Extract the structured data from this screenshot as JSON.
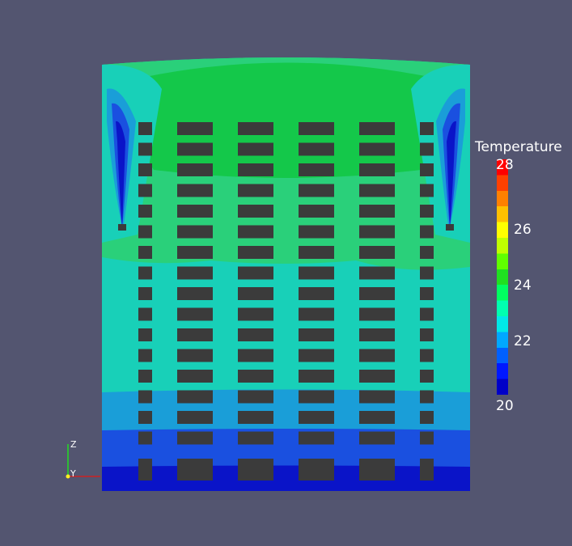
{
  "colorbar": {
    "title": "Temperature",
    "tick_labels": [
      "28",
      "26",
      "24",
      "22",
      "20"
    ],
    "colors": [
      "#0000c8",
      "#0018ff",
      "#0060ff",
      "#00a8ff",
      "#00e8e8",
      "#00ffb0",
      "#00ff60",
      "#20e020",
      "#60ff00",
      "#c0ff00",
      "#ffff00",
      "#ffc000",
      "#ff8000",
      "#ff4000",
      "#ff0000"
    ]
  },
  "orientation_axes": {
    "z_label": "Z",
    "y_label": "Y"
  },
  "colors": {
    "background": "#535570",
    "solid_block": "#3b3b3b",
    "zone_dark_blue": "#0a14c8",
    "zone_blue": "#1a50e0",
    "zone_light_blue": "#1a9ed8",
    "zone_teal": "#18d0b8",
    "zone_green": "#2ad07a",
    "zone_bright_green": "#14c84a"
  }
}
